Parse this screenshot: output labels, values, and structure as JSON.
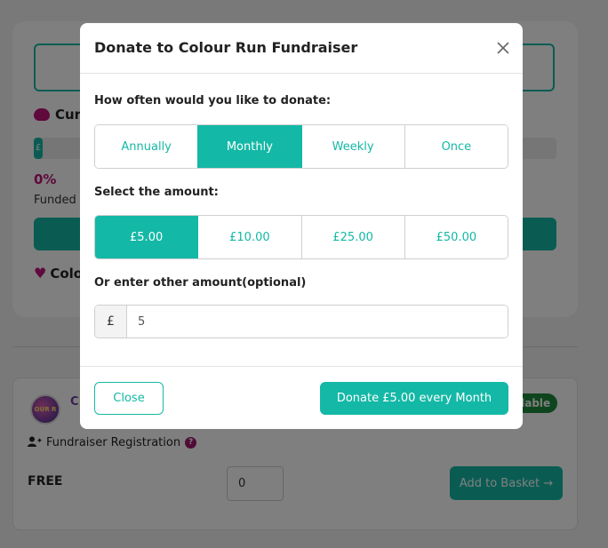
{
  "background": {
    "current_label": "Cur",
    "progress_badge": "£",
    "percent": "0%",
    "funded_label": "Funded",
    "colour_label": "Colo",
    "card": {
      "avatar_text": "OUR R",
      "title_partial": "C",
      "availability_badge": "ilable",
      "registration_label": "Fundraiser Registration",
      "help_glyph": "?",
      "price_label": "FREE",
      "quantity_value": "0",
      "add_to_basket_label": "Add to Basket →"
    }
  },
  "modal": {
    "title": "Donate to Colour Run Fundraiser",
    "frequency_prompt": "How often would you like to donate:",
    "frequency_options": [
      {
        "label": "Annually",
        "active": false
      },
      {
        "label": "Monthly",
        "active": true
      },
      {
        "label": "Weekly",
        "active": false
      },
      {
        "label": "Once",
        "active": false
      }
    ],
    "amount_prompt": "Select the amount:",
    "amount_options": [
      {
        "label": "£5.00",
        "active": true
      },
      {
        "label": "£10.00",
        "active": false
      },
      {
        "label": "£25.00",
        "active": false
      },
      {
        "label": "£50.00",
        "active": false
      }
    ],
    "other_amount_prompt": "Or enter other amount(optional)",
    "currency_symbol": "£",
    "other_amount_value": "5",
    "close_label": "Close",
    "donate_label": "Donate £5.00 every Month"
  },
  "colors": {
    "accent": "#14b8a6",
    "magenta": "#c0127a",
    "available_green": "#1f8a3c"
  }
}
